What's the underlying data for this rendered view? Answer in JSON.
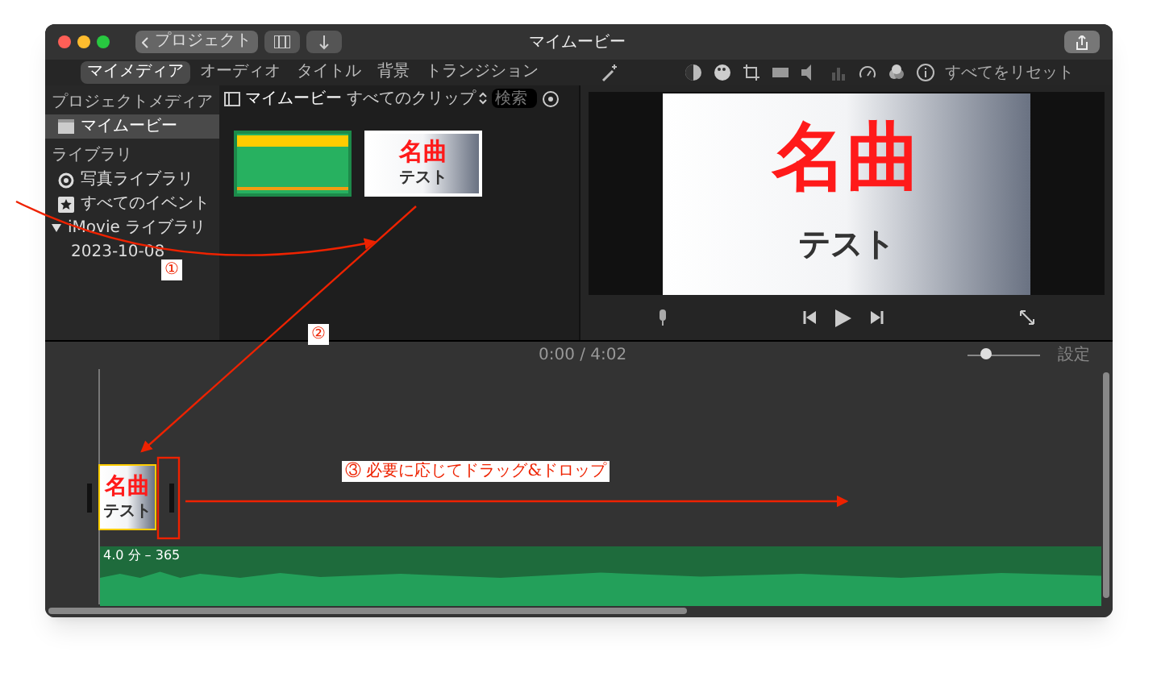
{
  "window": {
    "title": "マイムービー",
    "back_button": "プロジェクト"
  },
  "media_tabs": [
    {
      "label": "マイメディア",
      "selected": true
    },
    {
      "label": "オーディオ",
      "selected": false
    },
    {
      "label": "タイトル",
      "selected": false
    },
    {
      "label": "背景",
      "selected": false
    },
    {
      "label": "トランジション",
      "selected": false
    }
  ],
  "viewer_tools": {
    "reset": "すべてをリセット"
  },
  "sidebar": [
    {
      "heading": "プロジェクトメディア",
      "items": [
        {
          "kind": "project",
          "label": "マイムービー",
          "selected": true
        }
      ]
    },
    {
      "heading": "ライブラリ",
      "items": [
        {
          "kind": "photos",
          "label": "写真ライブラリ",
          "selected": false
        },
        {
          "kind": "events",
          "label": "すべてのイベント",
          "selected": false
        },
        {
          "kind": "library",
          "label": "iMovie ライブラリ",
          "expanded": true,
          "selected": false,
          "children": [
            {
              "label": "2023-10-08",
              "selected": false
            }
          ]
        }
      ]
    }
  ],
  "browser": {
    "title": "マイムービー",
    "filter": "すべてのクリップ",
    "search": {
      "placeholder": "検索"
    },
    "clips": [
      {
        "kind": "video",
        "selected": false
      },
      {
        "kind": "title",
        "title": "名曲",
        "subtitle": "テスト",
        "selected": true
      }
    ]
  },
  "viewer": {
    "title": "名曲",
    "subtitle": "テスト"
  },
  "timeline": {
    "time": "0:00 / 4:02",
    "settings": "設定",
    "zoom": {
      "level": 0.2
    },
    "clips": [
      {
        "title": "名曲",
        "subtitle": "テスト"
      }
    ],
    "audio": {
      "label": "4.0 分 – 365"
    }
  },
  "annotations": [
    {
      "label": "①"
    },
    {
      "label": "②"
    },
    {
      "label": "③ 必要に応じてドラッグ&ドロップ"
    }
  ]
}
